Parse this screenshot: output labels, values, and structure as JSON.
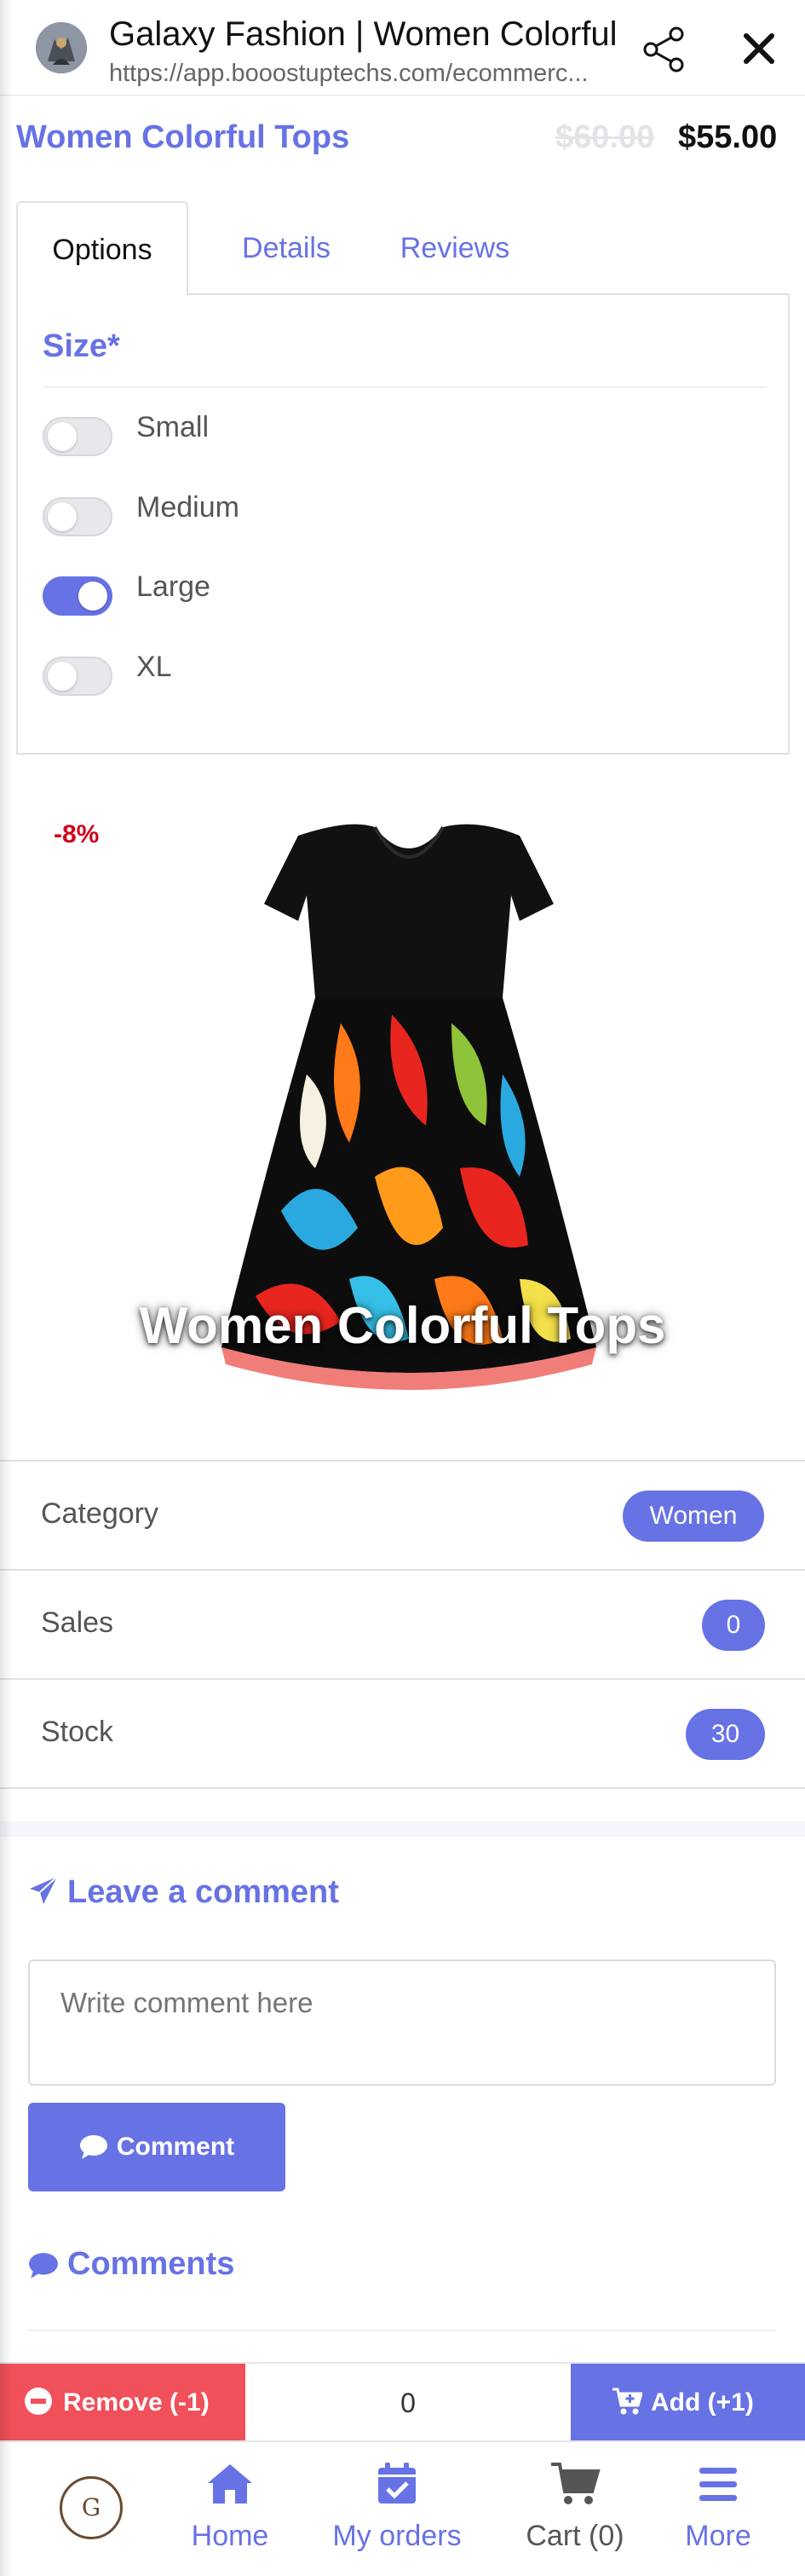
{
  "browser": {
    "title": "Galaxy Fashion | Women Colorful",
    "url": "https://app.booostuptechs.com/ecommerc..."
  },
  "product": {
    "title": "Women Colorful Tops",
    "old_price": "$60.00",
    "price": "$55.00",
    "discount": "-8%",
    "overlay_title": "Women Colorful Tops"
  },
  "tabs": [
    {
      "label": "Options",
      "active": true
    },
    {
      "label": "Details",
      "active": false
    },
    {
      "label": "Reviews",
      "active": false
    }
  ],
  "options": {
    "group_label": "Size*",
    "items": [
      {
        "label": "Small",
        "checked": false
      },
      {
        "label": "Medium",
        "checked": false
      },
      {
        "label": "Large",
        "checked": true
      },
      {
        "label": "XL",
        "checked": false
      }
    ]
  },
  "info": {
    "category": {
      "label": "Category",
      "value": "Women"
    },
    "sales": {
      "label": "Sales",
      "value": "0"
    },
    "stock": {
      "label": "Stock",
      "value": "30"
    }
  },
  "comment": {
    "heading": "Leave a comment",
    "placeholder": "Write comment here",
    "button": "Comment",
    "list_heading": "Comments"
  },
  "cart_bar": {
    "remove": "Remove (-1)",
    "quantity": "0",
    "add": "Add (+1)"
  },
  "nav": {
    "logo_letter": "G",
    "home": "Home",
    "orders": "My orders",
    "cart": "Cart (0)",
    "more": "More"
  },
  "colors": {
    "accent": "#6772e5",
    "danger": "#f0505a",
    "discount": "#d0021b"
  }
}
